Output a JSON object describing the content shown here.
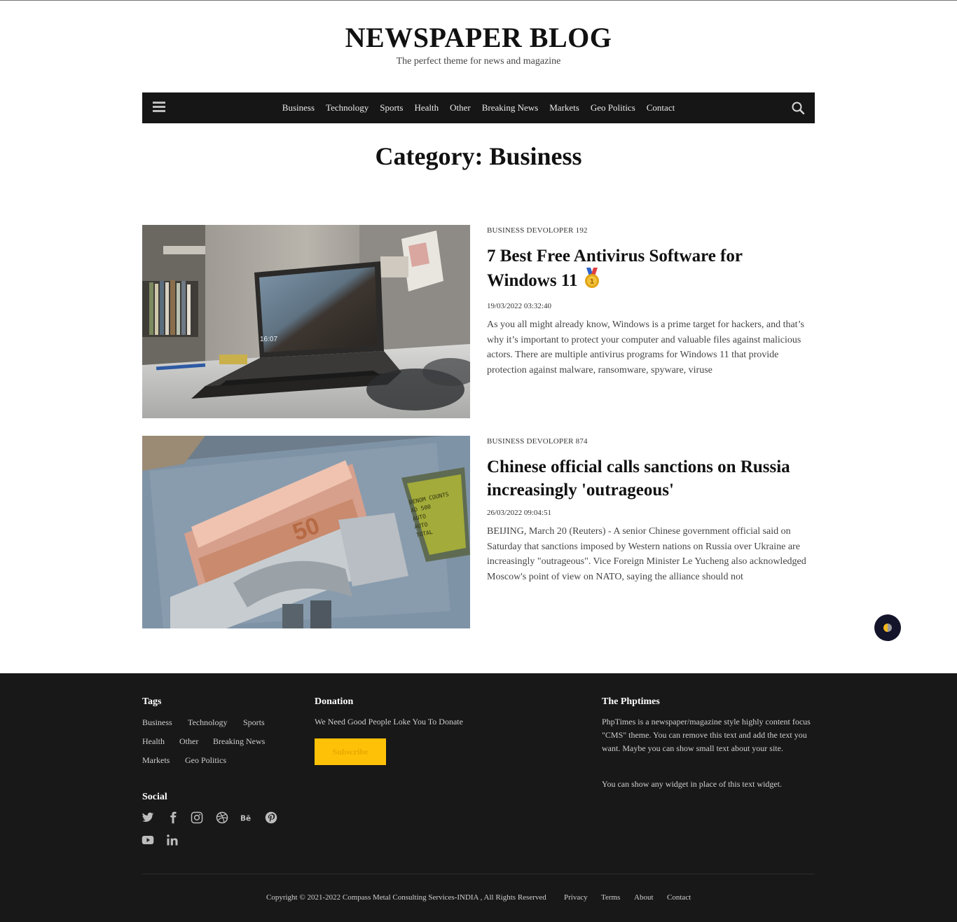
{
  "site": {
    "title": "NEWSPAPER BLOG",
    "tagline": "The perfect theme for news and magazine"
  },
  "nav": {
    "items": [
      "Business",
      "Technology",
      "Sports",
      "Health",
      "Other",
      "Breaking News",
      "Markets",
      "Geo Politics",
      "Contact"
    ]
  },
  "page": {
    "title": "Category: Business"
  },
  "posts": [
    {
      "meta": "BUSINESS DEVOLOPER 192",
      "title": "7 Best Free Antivirus Software for Windows 11",
      "date": "19/03/2022 03:32:40",
      "excerpt": "As you all might already know, Windows is a prime target for hackers, and that’s why it’s important to protect your computer and valuable files against malicious actors. There are multiple antivirus programs for Windows 11 that provide protection against malware, ransomware, spyware, viruse",
      "image_icon": "laptop-photo",
      "emoji_icon": "medal-icon",
      "laptop_clock": "16:07"
    },
    {
      "meta": "BUSINESS DEVOLOPER 874",
      "title": "Chinese official calls sanctions on Russia increasingly 'outrageous'",
      "date": "26/03/2022 09:04:51",
      "excerpt": "BEIJING, March 20 (Reuters) - A senior Chinese government official said on Saturday that sanctions imposed by Western nations on Russia over Ukraine are increasingly \"outrageous\". Vice Foreign Minister Le Yucheng also acknowledged Moscow's point of view on NATO, saying the alliance should not",
      "image_icon": "money-counter-photo",
      "banknote_value": "50"
    }
  ],
  "footer": {
    "tags_title": "Tags",
    "tags": [
      "Business",
      "Technology",
      "Sports",
      "Health",
      "Other",
      "Breaking News",
      "Markets",
      "Geo Politics"
    ],
    "donation_title": "Donation",
    "donation_text": "We Need Good People Loke You To Donate",
    "subscribe_label": "Subscribe",
    "about_title": "The Phptimes",
    "about_text_1": "PhpTimes is a newspaper/magazine style highly content focus \"CMS\" theme. You can remove this text and add the text you want. Maybe you can show small text about your site.",
    "about_text_2": "You can show any widget in place of this text widget.",
    "social_title": "Social",
    "social_icons": [
      "twitter-icon",
      "facebook-icon",
      "instagram-icon",
      "dribbble-icon",
      "behance-icon",
      "pinterest-icon",
      "youtube-icon",
      "linkedin-icon"
    ],
    "copyright": "Copyright © 2021-2022 Compass Metal Consulting Services-INDIA , All Rights Reserved",
    "links": [
      "Privacy",
      "Terms",
      "About",
      "Contact"
    ]
  },
  "colors": {
    "nav_bg": "#161616",
    "footer_bg": "#181818",
    "accent": "#ffc107",
    "scroll_button": "#14142a"
  }
}
